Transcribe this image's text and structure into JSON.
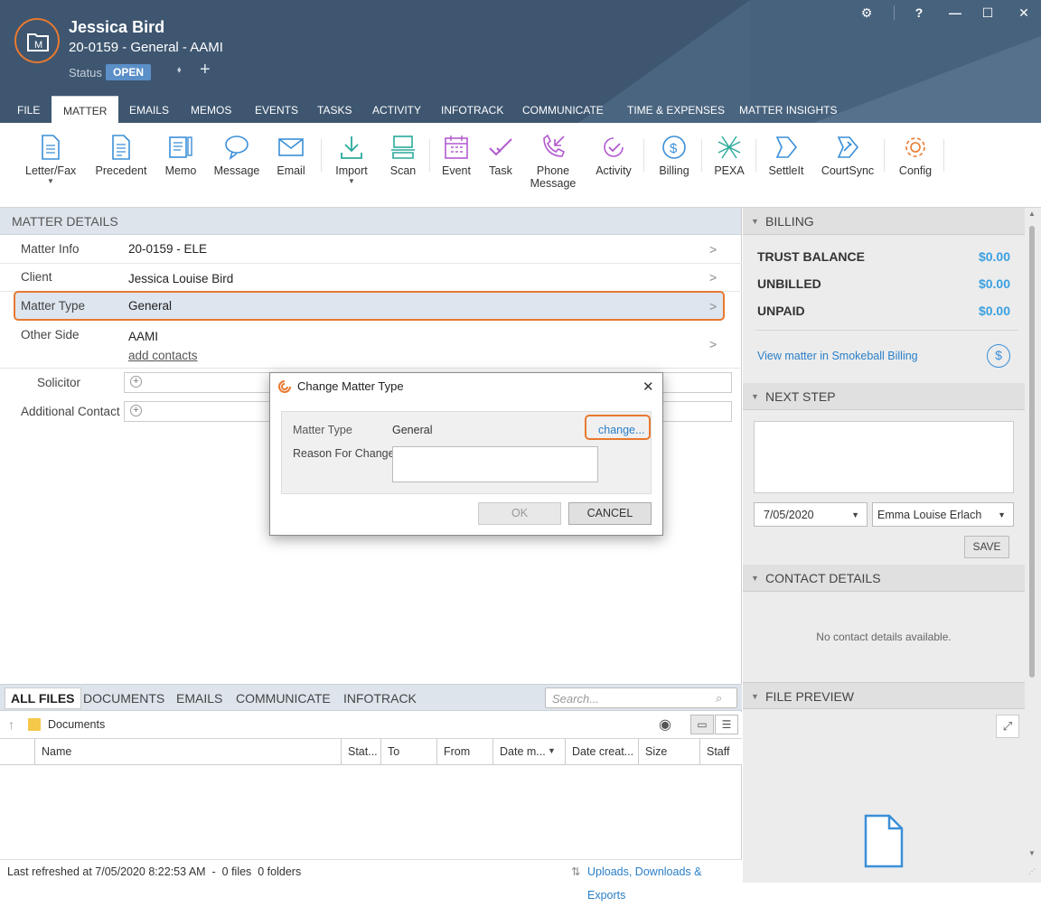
{
  "header": {
    "name": "Jessica Bird",
    "matter_line": "20-0159 - General - AAMI",
    "status_label": "Status",
    "status_value": "OPEN",
    "controls": [
      "⚙",
      "?",
      "—",
      "☐",
      "✕"
    ]
  },
  "tabs": [
    "FILE",
    "MATTER",
    "EMAILS",
    "MEMOS",
    "EVENTS",
    "TASKS",
    "ACTIVITY",
    "INFOTRACK",
    "COMMUNICATE",
    "TIME & EXPENSES",
    "MATTER INSIGHTS"
  ],
  "ribbon": {
    "letter_fax": "Letter/Fax",
    "precedent": "Precedent",
    "memo": "Memo",
    "message": "Message",
    "email": "Email",
    "import": "Import",
    "scan": "Scan",
    "event": "Event",
    "task": "Task",
    "phone_message_1": "Phone",
    "phone_message_2": "Message",
    "activity": "Activity",
    "billing": "Billing",
    "pexa": "PEXA",
    "settleit": "SettleIt",
    "courtsync": "CourtSync",
    "config": "Config"
  },
  "matter_details": {
    "title": "MATTER DETAILS",
    "matter_info_label": "Matter Info",
    "matter_info_value": "20-0159 - ELE",
    "client_label": "Client",
    "client_value": "Jessica Louise Bird",
    "matter_type_label": "Matter Type",
    "matter_type_value": "General",
    "other_side_label": "Other Side",
    "other_side_value": "AAMI",
    "add_contacts": "add contacts",
    "solicitor_label": "Solicitor",
    "additional_contact_label": "Additional Contact"
  },
  "dialog": {
    "title": "Change Matter Type",
    "matter_type_label": "Matter Type",
    "matter_type_value": "General",
    "change_link": "change...",
    "reason_label": "Reason For Change",
    "ok": "OK",
    "cancel": "CANCEL"
  },
  "files": {
    "tabs": [
      "ALL FILES",
      "DOCUMENTS",
      "EMAILS",
      "COMMUNICATE",
      "INFOTRACK"
    ],
    "search_placeholder": "Search...",
    "folder": "Documents",
    "columns": [
      "Name",
      "Stat...",
      "To",
      "From",
      "Date m...",
      "Date creat...",
      "Size",
      "Staff"
    ],
    "status_text": "Last refreshed at 7/05/2020 8:22:53 AM  -  0 files  0 folders",
    "uploads_link": "Uploads, Downloads & Exports"
  },
  "billing": {
    "title": "BILLING",
    "trust_label": "TRUST BALANCE",
    "trust_value": "$0.00",
    "unbilled_label": "UNBILLED",
    "unbilled_value": "$0.00",
    "unpaid_label": "UNPAID",
    "unpaid_value": "$0.00",
    "view_link": "View matter in Smokeball Billing"
  },
  "next_step": {
    "title": "NEXT STEP",
    "date": "7/05/2020",
    "staff": "Emma Louise Erlach",
    "save": "SAVE"
  },
  "contact_details": {
    "title": "CONTACT DETAILS",
    "empty": "No contact details available."
  },
  "file_preview": {
    "title": "FILE PREVIEW"
  },
  "colors": {
    "header_bg": "#3e5670",
    "accent_orange": "#e8792f",
    "icon_blue": "#3a8fd8",
    "icon_teal": "#2aaa9a",
    "icon_purple": "#b25ad0",
    "money_blue": "#3aa0e0"
  }
}
